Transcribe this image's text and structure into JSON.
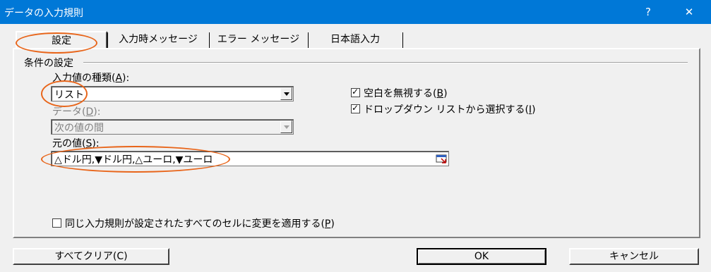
{
  "window": {
    "title": "データの入力規則",
    "help_glyph": "?",
    "close_glyph": "✕"
  },
  "tabs": [
    "設定",
    "入力時メッセージ",
    "エラー メッセージ",
    "日本語入力"
  ],
  "section_title": "条件の設定",
  "allow": {
    "label": "入力値の種類(",
    "accel": "A",
    "suffix": "):",
    "value": "リスト"
  },
  "data": {
    "label": "データ(",
    "accel": "D",
    "suffix": "):",
    "value": "次の値の間"
  },
  "source": {
    "label": "元の値(",
    "accel": "S",
    "suffix": "):",
    "value": "△ドル円,▼ドル円,△ユーロ,▼ユーロ"
  },
  "ignore_blank": {
    "label": "空白を無視する(",
    "accel": "B",
    "suffix": ")",
    "checked": true
  },
  "in_cell_dropdown": {
    "label": "ドロップダウン リストから選択する(",
    "accel": "I",
    "suffix": ")",
    "checked": true
  },
  "apply_all": {
    "label": "同じ入力規則が設定されたすべてのセルに変更を適用する(",
    "accel": "P",
    "suffix": ")",
    "checked": false
  },
  "buttons": {
    "clear_all": "すべてクリア(C)",
    "ok": "OK",
    "cancel": "キャンセル"
  },
  "check_glyph": "✓",
  "accent_color": "#e8651a",
  "titlebar_color": "#0078d7"
}
